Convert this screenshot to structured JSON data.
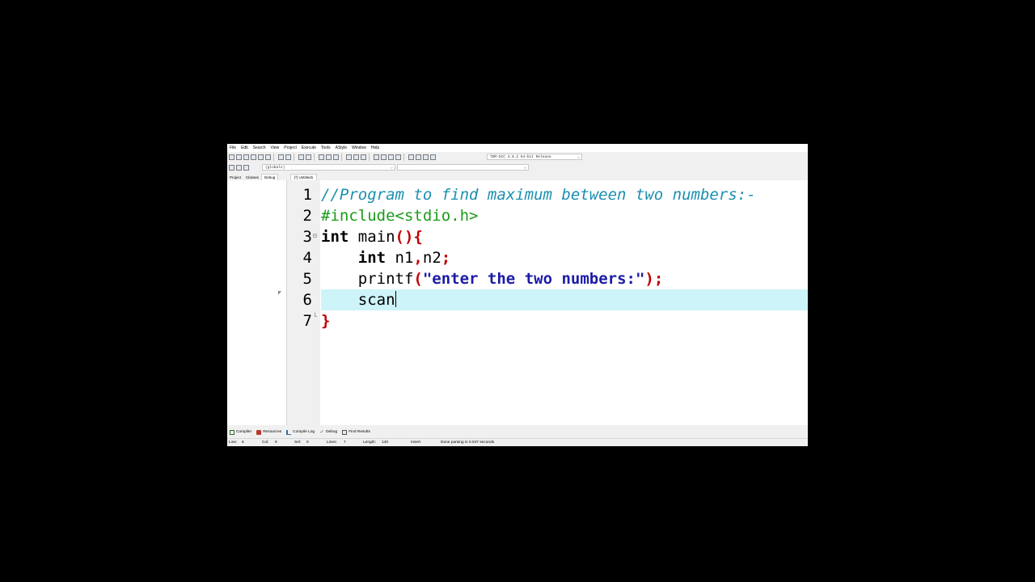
{
  "menu": [
    "File",
    "Edit",
    "Search",
    "View",
    "Project",
    "Execute",
    "Tools",
    "AStyle",
    "Window",
    "Help"
  ],
  "toolbar": {
    "compiler_select": "TDM-GCC 4.9.2 64-bit Release",
    "class_select": "(globals)",
    "member_select": ""
  },
  "side_tabs": [
    "Project",
    "Classes",
    "Debug"
  ],
  "file_tab": "[*] Untitled1",
  "editor": {
    "line_numbers": [
      "1",
      "2",
      "3",
      "4",
      "5",
      "6",
      "7"
    ],
    "lines": {
      "l1": "//Program to find maximum between two numbers:-",
      "l2": "#include<stdio.h>",
      "l3_kw": "int",
      "l3_mid": " main",
      "l3_brace": "(){",
      "l4_indent": "    ",
      "l4_kw": "int",
      "l4_a": " n1",
      "l4_comma": ",",
      "l4_b": "n2",
      "l4_semi": ";",
      "l5_indent": "    ",
      "l5_fn": "printf",
      "l5_paren_open": "(",
      "l5_str": "\"enter the two numbers:\"",
      "l5_paren_close": ");",
      "l6_indent": "    ",
      "l6_text": "scan",
      "l7": "}"
    },
    "current_line": "6"
  },
  "bottom_tabs": [
    "Compiler",
    "Resources",
    "Compile Log",
    "Debug",
    "Find Results"
  ],
  "status": {
    "line_label": "Line:",
    "line_value": "6",
    "col_label": "Col:",
    "col_value": "9",
    "sel_label": "Sel:",
    "sel_value": "0",
    "lines_label": "Lines:",
    "lines_value": "7",
    "length_label": "Length:",
    "length_value": "140",
    "mode": "Insert",
    "message": "Done parsing in 0.047 seconds"
  }
}
